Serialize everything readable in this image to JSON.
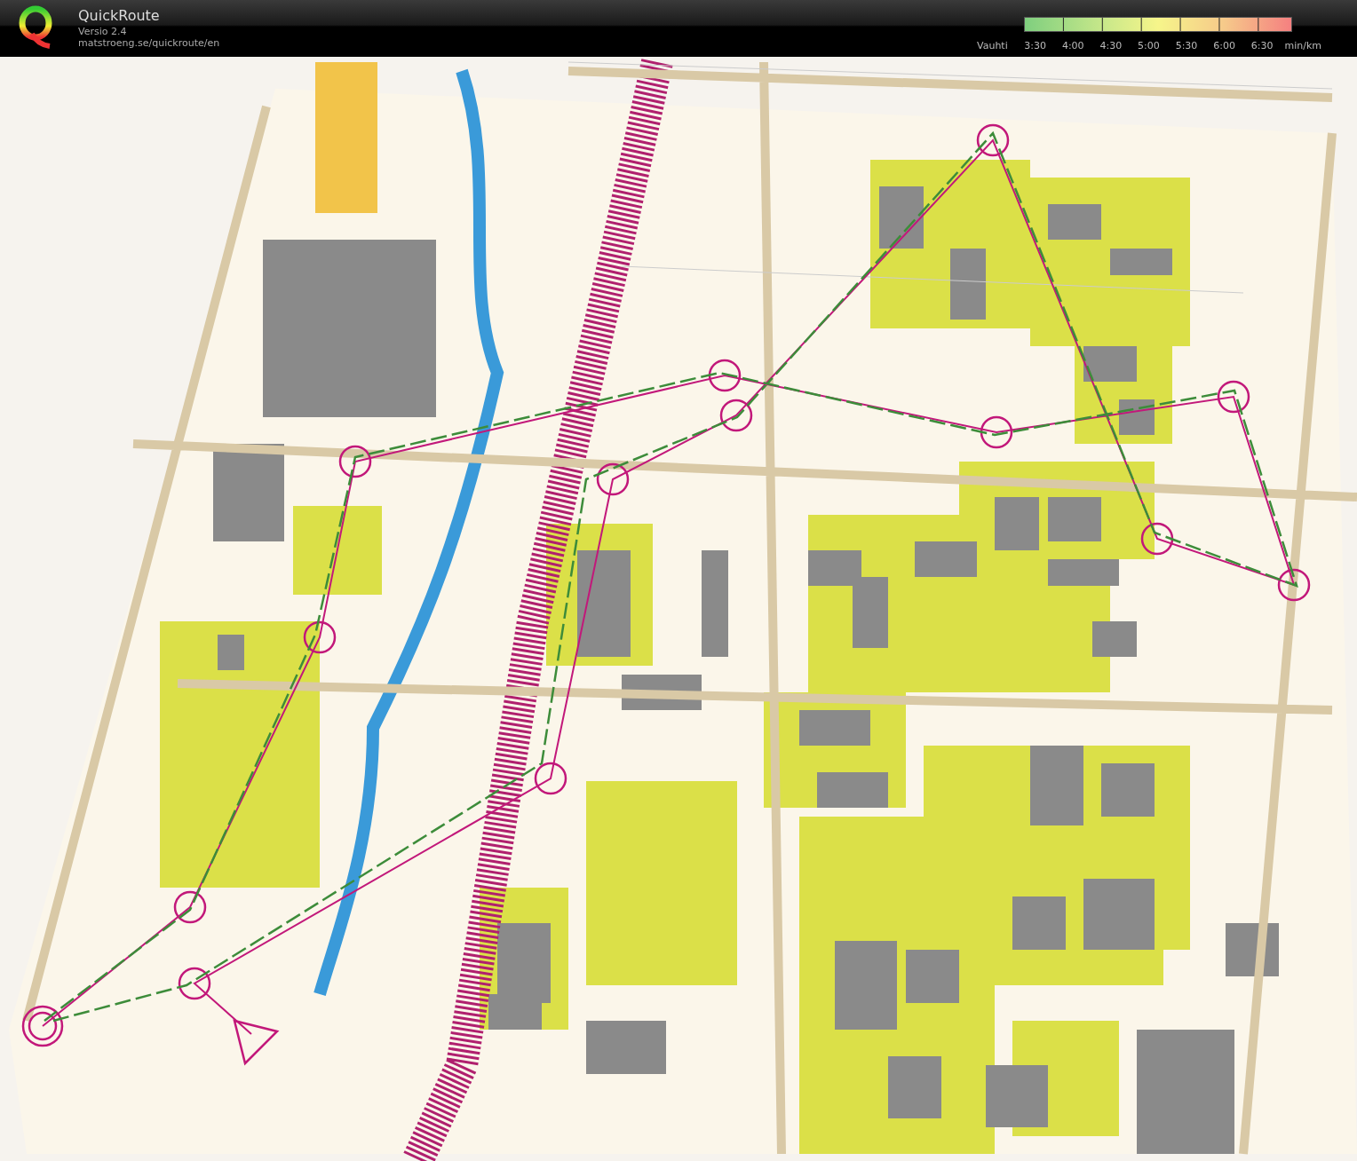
{
  "header": {
    "title": "QuickRoute",
    "version": "Versio 2.4",
    "url": "matstroeng.se/quickroute/en"
  },
  "pace_legend": {
    "label": "Vauhti",
    "ticks": [
      "3:30",
      "4:00",
      "4:30",
      "5:00",
      "5:30",
      "6:00",
      "6:30"
    ],
    "unit": "min/km"
  }
}
